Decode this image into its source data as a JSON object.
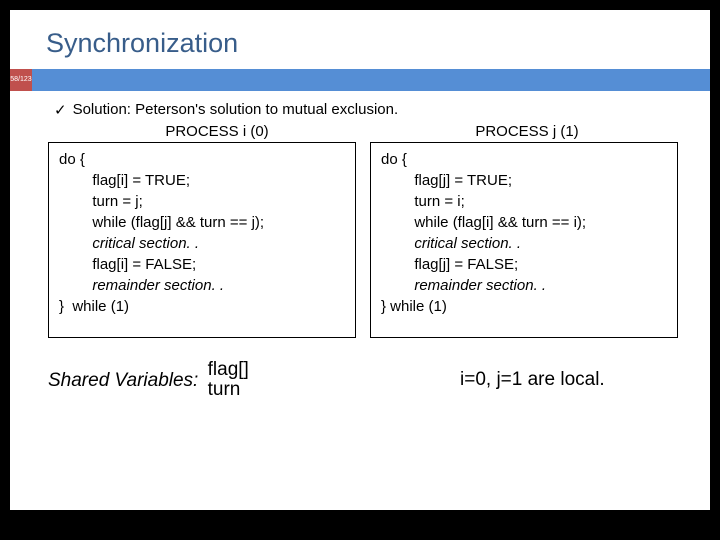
{
  "title": "Synchronization",
  "pagenum": "58/123",
  "bullet": "Solution: Peterson's solution to mutual exclusion.",
  "headers": {
    "left": "PROCESS i (0)",
    "right": "PROCESS j (1)"
  },
  "code": {
    "i": {
      "l1": "do {",
      "l2": "        flag[i] = TRUE;",
      "l3": "        turn = j;",
      "l4": "        while (flag[j] && turn == j);",
      "l5c": "        critical section. .",
      "l6": "        flag[i] = FALSE;",
      "l7c": "        remainder section. .",
      "l8": "}  while (1)"
    },
    "j": {
      "l1": "do {",
      "l2": "        flag[j] = TRUE;",
      "l3": "        turn = i;",
      "l4": "        while (flag[i] && turn == i);",
      "l5c": "        critical section. .",
      "l6": "        flag[j] = FALSE;",
      "l7c": "        remainder section. .",
      "l8": "} while (1)"
    }
  },
  "shared": {
    "label": "Shared Variables:",
    "v1": "flag[]",
    "v2": "turn"
  },
  "local": "i=0, j=1 are local."
}
